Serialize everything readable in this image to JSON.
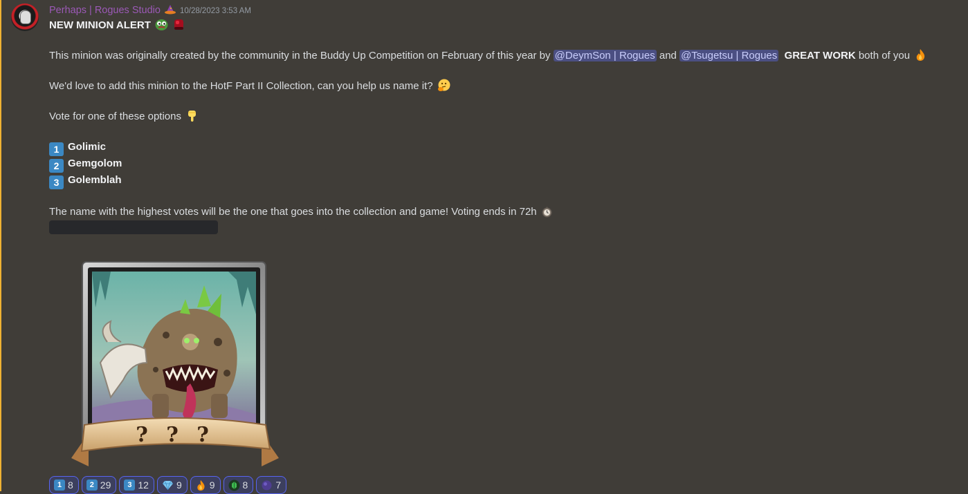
{
  "message": {
    "author": "Perhaps | Rogues Studio",
    "timestamp": "10/28/2023 3:53 AM",
    "title": "NEW MINION ALERT",
    "intro_before": "This minion was originally created by the community in the Buddy Up Competition on February of this year by ",
    "mention_1": "@DeymSon | Rogues",
    "and_text": " and ",
    "mention_2": "@Tsugetsu | Rogues",
    "great_work": "GREAT WORK",
    "both_of_you": " both of you",
    "help_text": "We'd love to add this minion to the HotF Part II Collection, can you help us name it?",
    "vote_text": "Vote for one of these options",
    "options": [
      {
        "number": "1",
        "name": "Golimic"
      },
      {
        "number": "2",
        "name": "Gemgolom"
      },
      {
        "number": "3",
        "name": "Golemblah"
      }
    ],
    "closing_text": "The name with the highest votes will be the one that goes into the collection and game! Voting ends in 72h",
    "card_label": "? ? ?"
  },
  "reactions": [
    {
      "emoji": "keycap-1",
      "number": "1",
      "count": "8"
    },
    {
      "emoji": "keycap-2",
      "number": "2",
      "count": "29"
    },
    {
      "emoji": "keycap-3",
      "number": "3",
      "count": "12"
    },
    {
      "emoji": "gem-icon",
      "count": "9"
    },
    {
      "emoji": "fire-icon",
      "count": "9"
    },
    {
      "emoji": "green-gem-icon",
      "count": "8"
    },
    {
      "emoji": "purple-orb-icon",
      "count": "7"
    }
  ],
  "colors": {
    "background": "#403d38",
    "author": "#9b59b6",
    "mention_bg": "#4b4f82",
    "keycap": "#3b88c3",
    "reaction_border": "#5865f2"
  }
}
